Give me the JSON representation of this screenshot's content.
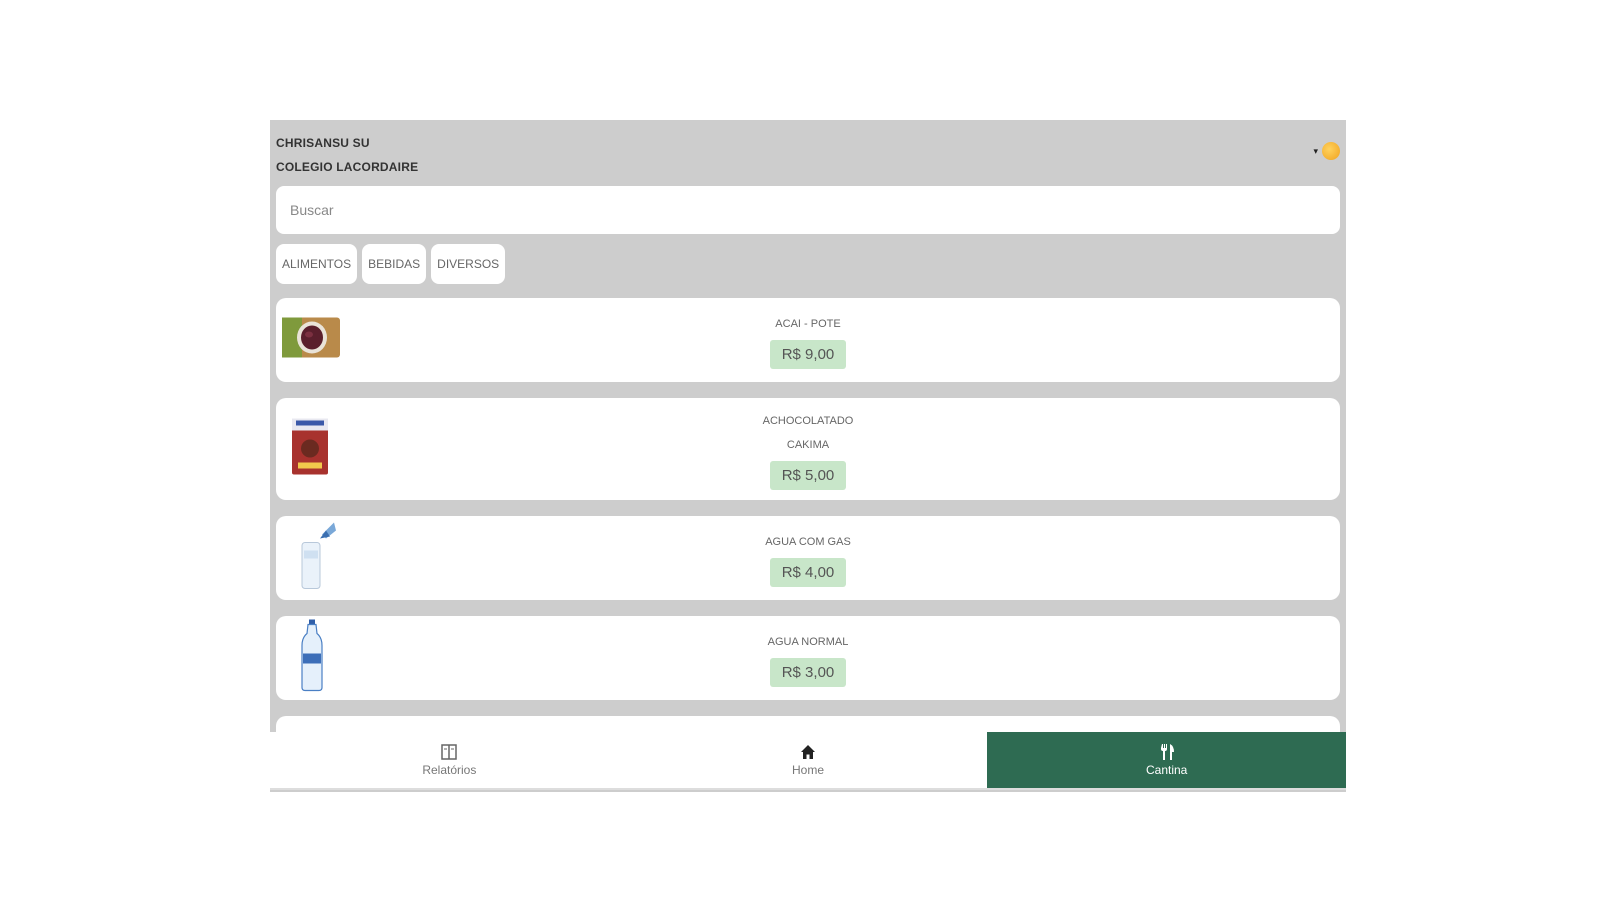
{
  "header": {
    "user_name": "CHRISANSU SU",
    "school_name": "COLEGIO LACORDAIRE",
    "caret": "▾"
  },
  "search": {
    "placeholder": "Buscar"
  },
  "tabs": [
    {
      "label": "ALIMENTOS"
    },
    {
      "label": "BEBIDAS"
    },
    {
      "label": "DIVERSOS"
    }
  ],
  "products": [
    {
      "name": "ACAI - POTE",
      "price": "R$ 9,00",
      "icon": "acai-bowl-icon"
    },
    {
      "name": "ACHOCOLATADO CAKIMA",
      "price": "R$ 5,00",
      "icon": "chocolate-milk-box-icon"
    },
    {
      "name": "AGUA COM GAS",
      "price": "R$ 4,00",
      "icon": "sparkling-water-icon"
    },
    {
      "name": "AGUA NORMAL",
      "price": "R$ 3,00",
      "icon": "water-bottle-icon"
    }
  ],
  "nav": [
    {
      "label": "Relatórios",
      "icon": "reports-icon"
    },
    {
      "label": "Home",
      "icon": "home-icon"
    },
    {
      "label": "Cantina",
      "icon": "cutlery-icon",
      "active": true
    }
  ],
  "colors": {
    "accent": "#2e6b52",
    "price_bg": "#c8e6c9",
    "background": "#cdcdcd"
  }
}
